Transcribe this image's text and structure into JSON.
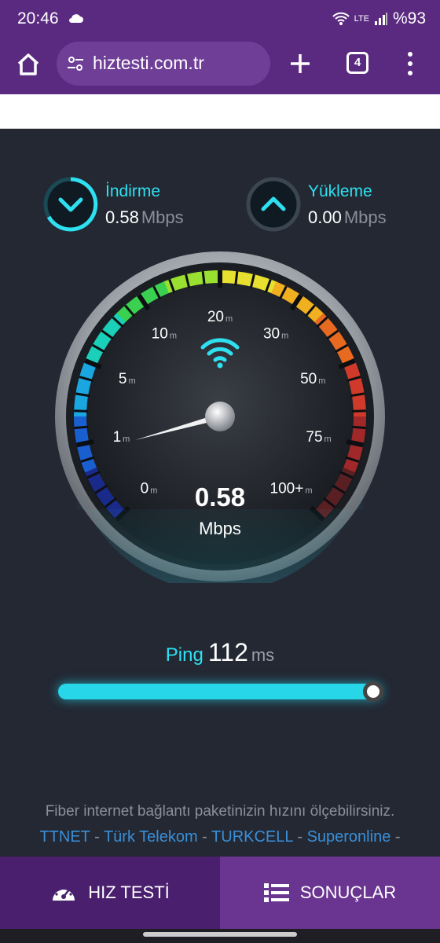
{
  "status_bar": {
    "time": "20:46",
    "battery": "%93",
    "network": "LTE"
  },
  "browser": {
    "url": "hiztesti.com.tr",
    "tab_count": "4"
  },
  "download": {
    "label": "İndirme",
    "value": "0.58",
    "unit": "Mbps"
  },
  "upload": {
    "label": "Yükleme",
    "value": "0.00",
    "unit": "Mbps"
  },
  "gauge": {
    "reading": "0.58",
    "unit": "Mbps",
    "scale_labels": [
      "0",
      "1",
      "5",
      "10",
      "20",
      "30",
      "50",
      "75",
      "100+"
    ],
    "scale_suffix": "m"
  },
  "ping": {
    "label": "Ping",
    "value": "112",
    "unit": "ms"
  },
  "footer": {
    "text": "Fiber internet bağlantı paketinizin hızını ölçebilirsiniz.",
    "providers": [
      "TTNET",
      "Türk Telekom",
      "TURKCELL",
      "Superonline"
    ]
  },
  "nav": {
    "speedtest": "HIZ TESTİ",
    "results": "SONUÇLAR"
  }
}
